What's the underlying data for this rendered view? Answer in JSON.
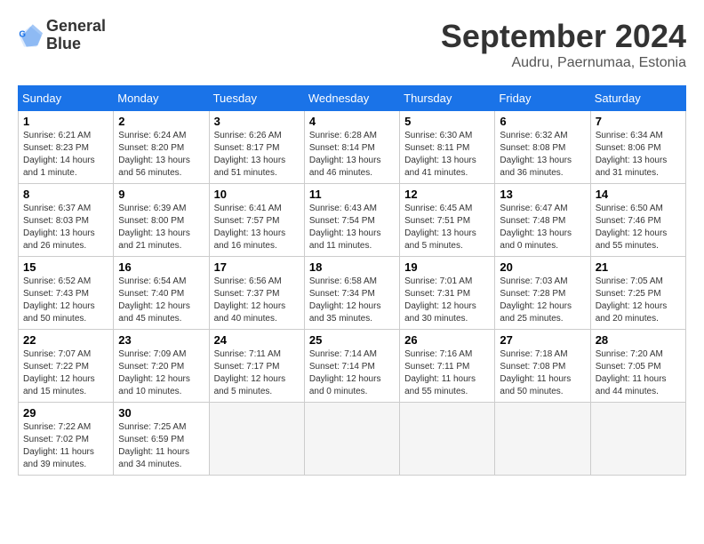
{
  "header": {
    "logo_line1": "General",
    "logo_line2": "Blue",
    "title": "September 2024",
    "subtitle": "Audru, Paernumaa, Estonia"
  },
  "weekdays": [
    "Sunday",
    "Monday",
    "Tuesday",
    "Wednesday",
    "Thursday",
    "Friday",
    "Saturday"
  ],
  "weeks": [
    [
      {
        "day": 1,
        "lines": [
          "Sunrise: 6:21 AM",
          "Sunset: 8:23 PM",
          "Daylight: 14 hours",
          "and 1 minute."
        ]
      },
      {
        "day": 2,
        "lines": [
          "Sunrise: 6:24 AM",
          "Sunset: 8:20 PM",
          "Daylight: 13 hours",
          "and 56 minutes."
        ]
      },
      {
        "day": 3,
        "lines": [
          "Sunrise: 6:26 AM",
          "Sunset: 8:17 PM",
          "Daylight: 13 hours",
          "and 51 minutes."
        ]
      },
      {
        "day": 4,
        "lines": [
          "Sunrise: 6:28 AM",
          "Sunset: 8:14 PM",
          "Daylight: 13 hours",
          "and 46 minutes."
        ]
      },
      {
        "day": 5,
        "lines": [
          "Sunrise: 6:30 AM",
          "Sunset: 8:11 PM",
          "Daylight: 13 hours",
          "and 41 minutes."
        ]
      },
      {
        "day": 6,
        "lines": [
          "Sunrise: 6:32 AM",
          "Sunset: 8:08 PM",
          "Daylight: 13 hours",
          "and 36 minutes."
        ]
      },
      {
        "day": 7,
        "lines": [
          "Sunrise: 6:34 AM",
          "Sunset: 8:06 PM",
          "Daylight: 13 hours",
          "and 31 minutes."
        ]
      }
    ],
    [
      {
        "day": 8,
        "lines": [
          "Sunrise: 6:37 AM",
          "Sunset: 8:03 PM",
          "Daylight: 13 hours",
          "and 26 minutes."
        ]
      },
      {
        "day": 9,
        "lines": [
          "Sunrise: 6:39 AM",
          "Sunset: 8:00 PM",
          "Daylight: 13 hours",
          "and 21 minutes."
        ]
      },
      {
        "day": 10,
        "lines": [
          "Sunrise: 6:41 AM",
          "Sunset: 7:57 PM",
          "Daylight: 13 hours",
          "and 16 minutes."
        ]
      },
      {
        "day": 11,
        "lines": [
          "Sunrise: 6:43 AM",
          "Sunset: 7:54 PM",
          "Daylight: 13 hours",
          "and 11 minutes."
        ]
      },
      {
        "day": 12,
        "lines": [
          "Sunrise: 6:45 AM",
          "Sunset: 7:51 PM",
          "Daylight: 13 hours",
          "and 5 minutes."
        ]
      },
      {
        "day": 13,
        "lines": [
          "Sunrise: 6:47 AM",
          "Sunset: 7:48 PM",
          "Daylight: 13 hours",
          "and 0 minutes."
        ]
      },
      {
        "day": 14,
        "lines": [
          "Sunrise: 6:50 AM",
          "Sunset: 7:46 PM",
          "Daylight: 12 hours",
          "and 55 minutes."
        ]
      }
    ],
    [
      {
        "day": 15,
        "lines": [
          "Sunrise: 6:52 AM",
          "Sunset: 7:43 PM",
          "Daylight: 12 hours",
          "and 50 minutes."
        ]
      },
      {
        "day": 16,
        "lines": [
          "Sunrise: 6:54 AM",
          "Sunset: 7:40 PM",
          "Daylight: 12 hours",
          "and 45 minutes."
        ]
      },
      {
        "day": 17,
        "lines": [
          "Sunrise: 6:56 AM",
          "Sunset: 7:37 PM",
          "Daylight: 12 hours",
          "and 40 minutes."
        ]
      },
      {
        "day": 18,
        "lines": [
          "Sunrise: 6:58 AM",
          "Sunset: 7:34 PM",
          "Daylight: 12 hours",
          "and 35 minutes."
        ]
      },
      {
        "day": 19,
        "lines": [
          "Sunrise: 7:01 AM",
          "Sunset: 7:31 PM",
          "Daylight: 12 hours",
          "and 30 minutes."
        ]
      },
      {
        "day": 20,
        "lines": [
          "Sunrise: 7:03 AM",
          "Sunset: 7:28 PM",
          "Daylight: 12 hours",
          "and 25 minutes."
        ]
      },
      {
        "day": 21,
        "lines": [
          "Sunrise: 7:05 AM",
          "Sunset: 7:25 PM",
          "Daylight: 12 hours",
          "and 20 minutes."
        ]
      }
    ],
    [
      {
        "day": 22,
        "lines": [
          "Sunrise: 7:07 AM",
          "Sunset: 7:22 PM",
          "Daylight: 12 hours",
          "and 15 minutes."
        ]
      },
      {
        "day": 23,
        "lines": [
          "Sunrise: 7:09 AM",
          "Sunset: 7:20 PM",
          "Daylight: 12 hours",
          "and 10 minutes."
        ]
      },
      {
        "day": 24,
        "lines": [
          "Sunrise: 7:11 AM",
          "Sunset: 7:17 PM",
          "Daylight: 12 hours",
          "and 5 minutes."
        ]
      },
      {
        "day": 25,
        "lines": [
          "Sunrise: 7:14 AM",
          "Sunset: 7:14 PM",
          "Daylight: 12 hours",
          "and 0 minutes."
        ]
      },
      {
        "day": 26,
        "lines": [
          "Sunrise: 7:16 AM",
          "Sunset: 7:11 PM",
          "Daylight: 11 hours",
          "and 55 minutes."
        ]
      },
      {
        "day": 27,
        "lines": [
          "Sunrise: 7:18 AM",
          "Sunset: 7:08 PM",
          "Daylight: 11 hours",
          "and 50 minutes."
        ]
      },
      {
        "day": 28,
        "lines": [
          "Sunrise: 7:20 AM",
          "Sunset: 7:05 PM",
          "Daylight: 11 hours",
          "and 44 minutes."
        ]
      }
    ],
    [
      {
        "day": 29,
        "lines": [
          "Sunrise: 7:22 AM",
          "Sunset: 7:02 PM",
          "Daylight: 11 hours",
          "and 39 minutes."
        ]
      },
      {
        "day": 30,
        "lines": [
          "Sunrise: 7:25 AM",
          "Sunset: 6:59 PM",
          "Daylight: 11 hours",
          "and 34 minutes."
        ]
      },
      null,
      null,
      null,
      null,
      null
    ]
  ]
}
